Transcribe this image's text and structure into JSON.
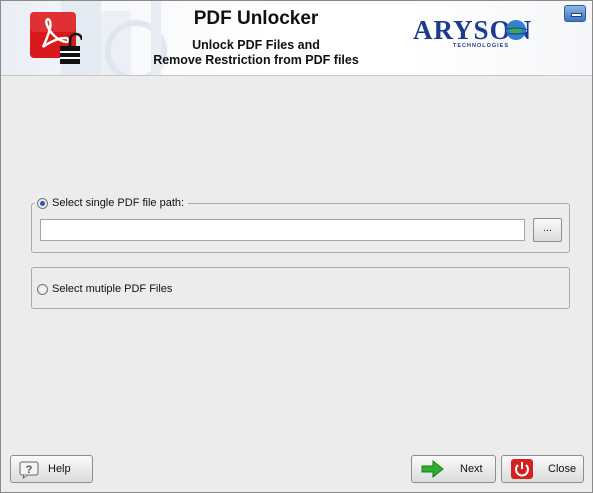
{
  "header": {
    "title": "PDF Unlocker",
    "subtitle_line1": "Unlock PDF Files and",
    "subtitle_line2": "Remove Restriction from PDF files",
    "brand": "ARYSON",
    "brand_tagline": "TECHNOLOGIES"
  },
  "options": {
    "single": {
      "label": "Select single PDF file path:",
      "selected": true
    },
    "multiple": {
      "label": "Select mutiple PDF Files",
      "selected": false
    }
  },
  "path_input": {
    "value": ""
  },
  "browse": {
    "label": "..."
  },
  "footer": {
    "help_label": "Help",
    "next_label": "Next",
    "close_label": "Close"
  },
  "colors": {
    "accent": "#2b5aa5",
    "pdf_red": "#d7191c",
    "next_green": "#2fae2f",
    "close_red": "#d62121",
    "brand_blue": "#1d3b8c"
  },
  "icons": [
    "pdf-unlock-logo-icon",
    "aryson-globe-icon",
    "minimize-icon",
    "help-icon",
    "arrow-right-icon",
    "power-icon"
  ]
}
